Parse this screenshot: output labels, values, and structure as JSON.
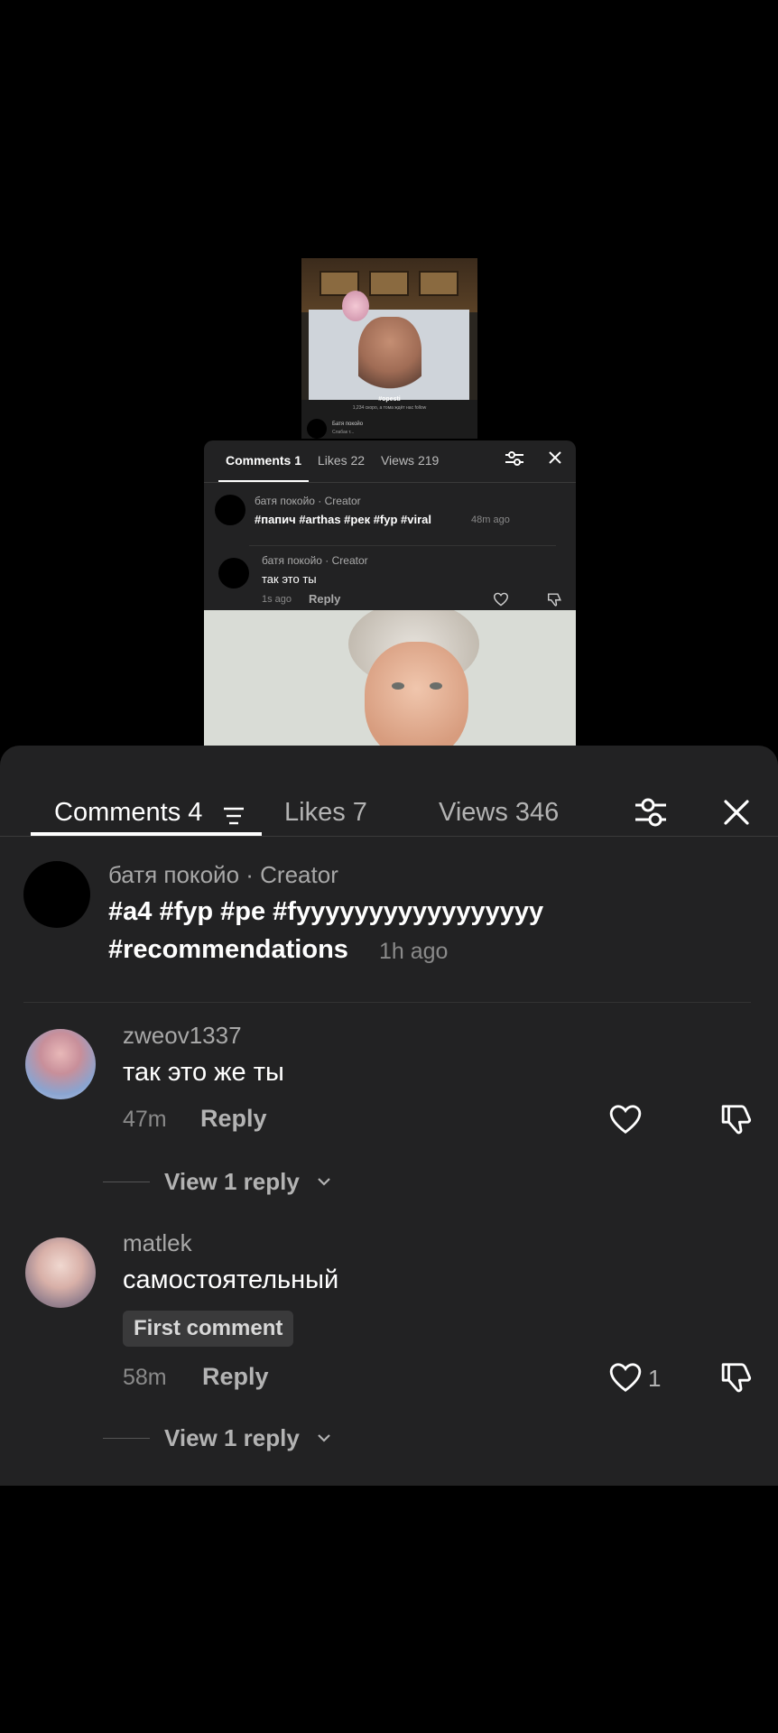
{
  "mini_video": {
    "title": "#opesti",
    "subtitle": "1,234 скоро, а тома ждёт нас follow",
    "comment_name": "Батя покойо",
    "comment_text": "Слабак т..."
  },
  "mid_panel": {
    "tabs": [
      "Comments 1",
      "Likes 22",
      "Views 219"
    ],
    "comments": [
      {
        "name": "батя покойо · Creator",
        "text": "#папич #arthas #рек #fyp #viral",
        "time": "48m ago"
      },
      {
        "name": "батя покойо · Creator",
        "text": "так это ты",
        "time": "1s ago",
        "reply": "Reply"
      }
    ]
  },
  "sheet": {
    "tab_comments": "Comments 4",
    "tab_likes": "Likes 7",
    "tab_views": "Views 346",
    "creator": {
      "name": "батя покойо · Creator",
      "line1": "#a4 #fyp #pe #fyyyyyyyyyyyyyyyyy",
      "line2": "#recommendations",
      "time": "1h ago"
    },
    "comments": [
      {
        "name": "zweov1337",
        "text": "так это же ты",
        "time": "47m",
        "reply": "Reply",
        "view_replies": "View 1 reply"
      },
      {
        "name": "matlek",
        "text": "самостоятельный",
        "badge": "First comment",
        "time": "58m",
        "reply": "Reply",
        "likes": "1",
        "view_replies": "View 1 reply"
      }
    ]
  },
  "icons": [
    "sort-icon",
    "filter-icon",
    "close-icon",
    "heart-icon",
    "dislike-icon",
    "chevron-down-icon"
  ]
}
